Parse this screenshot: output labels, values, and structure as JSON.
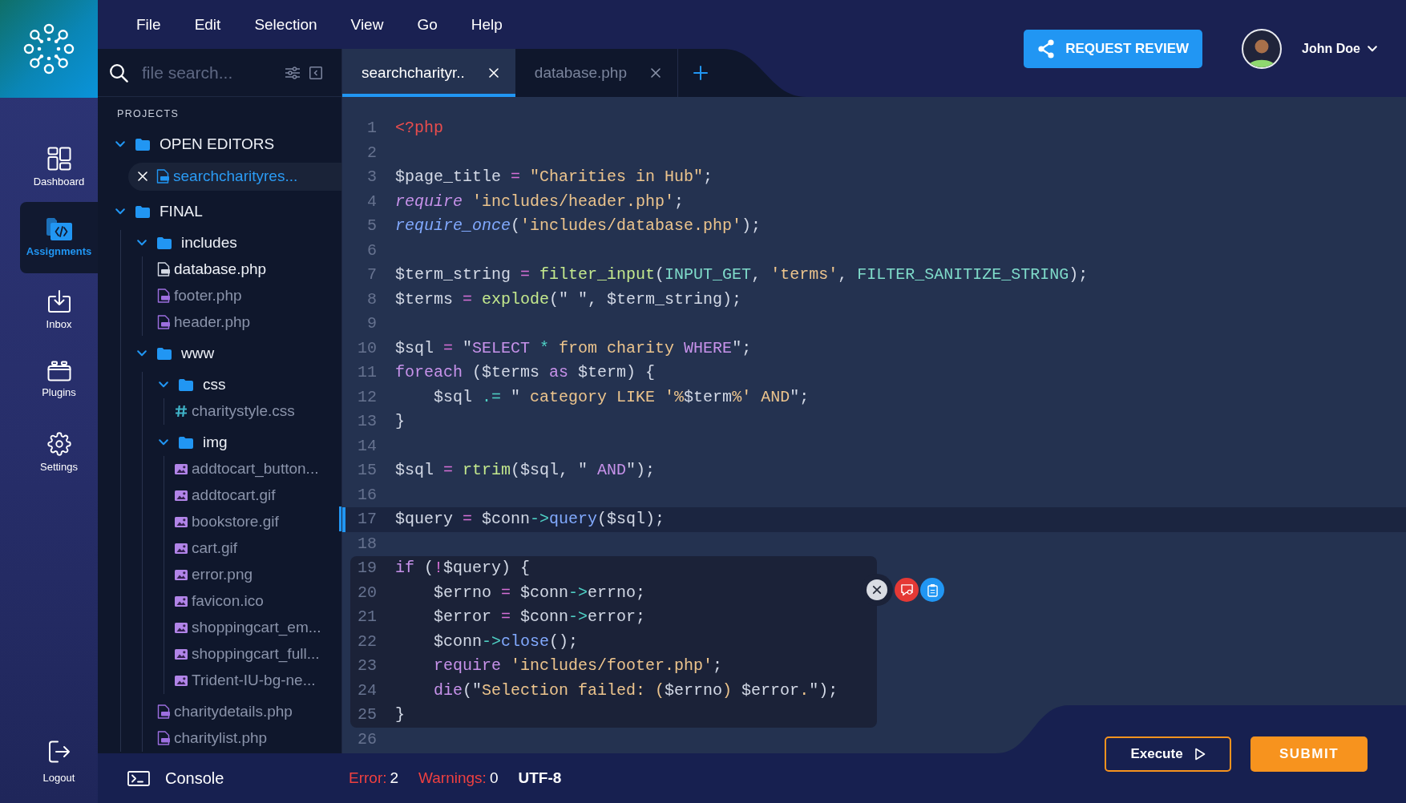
{
  "sidebar": {
    "items": [
      {
        "label": "Dashboard",
        "selected": false
      },
      {
        "label": "Assignments",
        "selected": true
      },
      {
        "label": "Inbox",
        "selected": false
      },
      {
        "label": "Plugins",
        "selected": false
      },
      {
        "label": "Settings",
        "selected": false
      }
    ],
    "logout": {
      "label": "Logout"
    }
  },
  "menu": [
    "File",
    "Edit",
    "Selection",
    "View",
    "Go",
    "Help"
  ],
  "header": {
    "review_button": "REQUEST REVIEW",
    "user": {
      "name": "John Doe"
    }
  },
  "explorer": {
    "search": {
      "placeholder": "file search..."
    },
    "section_title": "PROJECTS",
    "tree": [
      {
        "label": "OPEN EDITORS",
        "kind": "folder",
        "expanded": true,
        "selected": false,
        "children": [
          {
            "label": "searchcharityres...",
            "kind": "editor",
            "selected": true
          }
        ]
      },
      {
        "label": "FINAL",
        "kind": "folder",
        "expanded": true,
        "selected": false,
        "children": [
          {
            "label": "includes",
            "kind": "folder",
            "expanded": true,
            "selected": false,
            "children": [
              {
                "label": "database.php",
                "kind": "php",
                "selected": false,
                "open": true
              },
              {
                "label": "footer.php",
                "kind": "php",
                "selected": false,
                "open": false
              },
              {
                "label": "header.php",
                "kind": "php",
                "selected": false,
                "open": false
              }
            ]
          },
          {
            "label": "www",
            "kind": "folder",
            "expanded": true,
            "selected": false,
            "children": [
              {
                "label": "css",
                "kind": "folder",
                "expanded": true,
                "selected": false,
                "children": [
                  {
                    "label": "charitystyle.css",
                    "kind": "css",
                    "selected": false,
                    "open": false
                  }
                ]
              },
              {
                "label": "img",
                "kind": "folder",
                "expanded": true,
                "selected": false,
                "children": [
                  {
                    "label": "addtocart_button...",
                    "kind": "image",
                    "selected": false,
                    "open": false
                  },
                  {
                    "label": "addtocart.gif",
                    "kind": "image",
                    "selected": false,
                    "open": false
                  },
                  {
                    "label": "bookstore.gif",
                    "kind": "image",
                    "selected": false,
                    "open": false
                  },
                  {
                    "label": "cart.gif",
                    "kind": "image",
                    "selected": false,
                    "open": false
                  },
                  {
                    "label": "error.png",
                    "kind": "image",
                    "selected": false,
                    "open": false
                  },
                  {
                    "label": "favicon.ico",
                    "kind": "image",
                    "selected": false,
                    "open": false
                  },
                  {
                    "label": "shoppingcart_em...",
                    "kind": "image",
                    "selected": false,
                    "open": false
                  },
                  {
                    "label": "shoppingcart_full...",
                    "kind": "image",
                    "selected": false,
                    "open": false
                  },
                  {
                    "label": "Trident-IU-bg-ne...",
                    "kind": "image",
                    "selected": false,
                    "open": false
                  }
                ]
              },
              {
                "label": "charitydetails.php",
                "kind": "php",
                "selected": false,
                "open": false
              },
              {
                "label": "charitylist.php",
                "kind": "php",
                "selected": false,
                "open": false
              }
            ]
          }
        ]
      }
    ]
  },
  "tabs": [
    {
      "label": "searchcharityr..",
      "selected": true
    },
    {
      "label": "database.php",
      "selected": false
    }
  ],
  "editor": {
    "blocks": [
      {
        "kind": "normal",
        "lines": [
          {
            "number": "1",
            "current": false,
            "tokens": [
              {
                "kind": "tag",
                "text": "<?php"
              }
            ]
          },
          {
            "number": "2",
            "current": false
          },
          {
            "number": "3",
            "current": false,
            "tokens": [
              {
                "kind": "plain",
                "text": "$page_title "
              },
              {
                "kind": "op",
                "text": "= "
              },
              {
                "kind": "str",
                "text": "\"Charities in Hub\""
              },
              {
                "kind": "plain",
                "text": ";"
              }
            ]
          },
          {
            "number": "4",
            "current": false,
            "tokens": [
              {
                "kind": "import",
                "text": "require"
              },
              {
                "kind": "str",
                "text": " 'includes/header.php'"
              },
              {
                "kind": "plain",
                "text": ";"
              }
            ]
          },
          {
            "number": "5",
            "current": false,
            "tokens": [
              {
                "kind": "importcall",
                "text": "require_once"
              },
              {
                "kind": "plain",
                "text": "("
              },
              {
                "kind": "str",
                "text": "'includes/database.php'"
              },
              {
                "kind": "plain",
                "text": ");"
              }
            ]
          },
          {
            "number": "6",
            "current": false
          },
          {
            "number": "7",
            "current": false,
            "tokens": [
              {
                "kind": "plain",
                "text": "$term_string "
              },
              {
                "kind": "op",
                "text": "= "
              },
              {
                "kind": "func",
                "text": "filter_input"
              },
              {
                "kind": "plain",
                "text": "("
              },
              {
                "kind": "const",
                "text": "INPUT_GET"
              },
              {
                "kind": "plain",
                "text": ", "
              },
              {
                "kind": "str",
                "text": "'terms'"
              },
              {
                "kind": "plain",
                "text": ", "
              },
              {
                "kind": "const",
                "text": "FILTER_SANITIZE_STRING"
              },
              {
                "kind": "plain",
                "text": ");"
              }
            ]
          },
          {
            "number": "8",
            "current": false,
            "tokens": [
              {
                "kind": "plain",
                "text": "$terms "
              },
              {
                "kind": "op",
                "text": "= "
              },
              {
                "kind": "func",
                "text": "explode"
              },
              {
                "kind": "plain",
                "text": "(\" \", $term_string);"
              }
            ]
          },
          {
            "number": "9",
            "current": false
          },
          {
            "number": "10",
            "current": false,
            "tokens": [
              {
                "kind": "plain",
                "text": "$sql "
              },
              {
                "kind": "op",
                "text": "="
              },
              {
                "kind": "plain",
                "text": " \""
              },
              {
                "kind": "keyword",
                "text": "SELECT"
              },
              {
                "kind": "arrow",
                "text": " * "
              },
              {
                "kind": "str",
                "text": "from charity"
              },
              {
                "kind": "keyword",
                "text": " WHERE"
              },
              {
                "kind": "plain",
                "text": "\";"
              }
            ]
          },
          {
            "number": "11",
            "current": false,
            "tokens": [
              {
                "kind": "keyword",
                "text": "foreach"
              },
              {
                "kind": "plain",
                "text": " ($terms "
              },
              {
                "kind": "keyword",
                "text": "as"
              },
              {
                "kind": "plain",
                "text": " $term) {"
              }
            ]
          },
          {
            "number": "12",
            "current": false,
            "tokens": [
              {
                "kind": "plain",
                "text": "    $sql "
              },
              {
                "kind": "arrow",
                "text": ".="
              },
              {
                "kind": "plain",
                "text": " \""
              },
              {
                "kind": "str",
                "text": " category LIKE '%"
              },
              {
                "kind": "plain",
                "text": "$term"
              },
              {
                "kind": "str",
                "text": "%' AND"
              },
              {
                "kind": "plain",
                "text": "\";"
              }
            ]
          },
          {
            "number": "13",
            "current": false,
            "tokens": [
              {
                "kind": "plain",
                "text": "}"
              }
            ]
          },
          {
            "number": "14",
            "current": false
          },
          {
            "number": "15",
            "current": false,
            "tokens": [
              {
                "kind": "plain",
                "text": "$sql "
              },
              {
                "kind": "op",
                "text": "= "
              },
              {
                "kind": "func",
                "text": "rtrim"
              },
              {
                "kind": "plain",
                "text": "($sql, \" "
              },
              {
                "kind": "keyword",
                "text": "AND"
              },
              {
                "kind": "plain",
                "text": "\");"
              }
            ]
          },
          {
            "number": "16",
            "current": false
          },
          {
            "number": "17",
            "current": true,
            "tokens": [
              {
                "kind": "plain",
                "text": "$query "
              },
              {
                "kind": "op",
                "text": "="
              },
              {
                "kind": "plain",
                "text": " $conn"
              },
              {
                "kind": "arrow",
                "text": "->"
              },
              {
                "kind": "method",
                "text": "query"
              },
              {
                "kind": "plain",
                "text": "($sql);"
              }
            ]
          },
          {
            "number": "18",
            "current": false
          }
        ]
      },
      {
        "kind": "flagged",
        "lines": [
          {
            "number": "19",
            "current": false,
            "tokens": [
              {
                "kind": "keyword",
                "text": "if"
              },
              {
                "kind": "plain",
                "text": " ("
              },
              {
                "kind": "op",
                "text": "!"
              },
              {
                "kind": "plain",
                "text": "$query) {"
              }
            ]
          },
          {
            "number": "20",
            "current": false,
            "tokens": [
              {
                "kind": "plain",
                "text": "    $errno "
              },
              {
                "kind": "op",
                "text": "="
              },
              {
                "kind": "plain",
                "text": " $conn"
              },
              {
                "kind": "arrow",
                "text": "->"
              },
              {
                "kind": "plain",
                "text": "errno;"
              }
            ]
          },
          {
            "number": "21",
            "current": false,
            "tokens": [
              {
                "kind": "plain",
                "text": "    $error "
              },
              {
                "kind": "op",
                "text": "="
              },
              {
                "kind": "plain",
                "text": " $conn"
              },
              {
                "kind": "arrow",
                "text": "->"
              },
              {
                "kind": "plain",
                "text": "error;"
              }
            ]
          },
          {
            "number": "22",
            "current": false,
            "tokens": [
              {
                "kind": "plain",
                "text": "    $conn"
              },
              {
                "kind": "arrow",
                "text": "->"
              },
              {
                "kind": "method",
                "text": "close"
              },
              {
                "kind": "plain",
                "text": "();"
              }
            ]
          },
          {
            "number": "23",
            "current": false,
            "tokens": [
              {
                "kind": "keyword",
                "text": "    require"
              },
              {
                "kind": "str",
                "text": " 'includes/footer.php'"
              },
              {
                "kind": "plain",
                "text": ";"
              }
            ]
          },
          {
            "number": "24",
            "current": false,
            "tokens": [
              {
                "kind": "keyword",
                "text": "    die"
              },
              {
                "kind": "plain",
                "text": "(\""
              },
              {
                "kind": "str",
                "text": "Selection failed: ("
              },
              {
                "kind": "plain",
                "text": "$errno"
              },
              {
                "kind": "str",
                "text": ")"
              },
              {
                "kind": "plain",
                "text": " $error"
              },
              {
                "kind": "str",
                "text": "."
              },
              {
                "kind": "plain",
                "text": "\");"
              }
            ]
          },
          {
            "number": "25",
            "current": false,
            "tokens": [
              {
                "kind": "plain",
                "text": "}"
              }
            ]
          }
        ]
      },
      {
        "kind": "normal",
        "lines": [
          {
            "number": "26",
            "current": false
          }
        ]
      }
    ]
  },
  "status_bar": {
    "console": "Console",
    "errors": {
      "label": "Error:",
      "count": "2"
    },
    "warnings": {
      "label": "Warnings:",
      "count": "0"
    },
    "encoding": "UTF-8"
  },
  "actions": {
    "execute": "Execute",
    "submit": "SUBMIT"
  }
}
